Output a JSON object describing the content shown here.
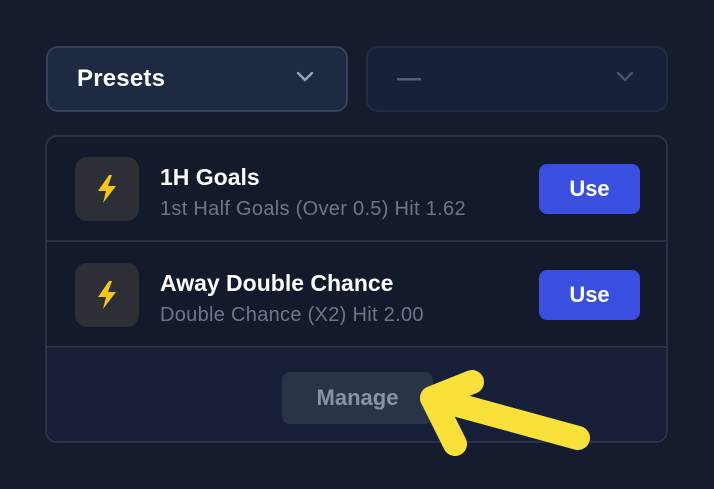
{
  "selects": {
    "presets": {
      "label": "Presets",
      "icon": "chevron-down-icon"
    },
    "second": {
      "value": "—",
      "icon": "chevron-down-icon"
    }
  },
  "presets": [
    {
      "title": "1H Goals",
      "subtitle": "1st Half Goals (Over 0.5) Hit 1.62",
      "button": "Use",
      "icon": "lightning-bolt-icon"
    },
    {
      "title": "Away Double Chance",
      "subtitle": "Double Chance (X2) Hit 2.00",
      "button": "Use",
      "icon": "lightning-bolt-icon"
    }
  ],
  "footer": {
    "manage_label": "Manage"
  },
  "colors": {
    "background": "#141c2d",
    "accent_button": "#3a4ee0",
    "bolt": "#f5c518",
    "annotation_arrow": "#f9e13a"
  }
}
